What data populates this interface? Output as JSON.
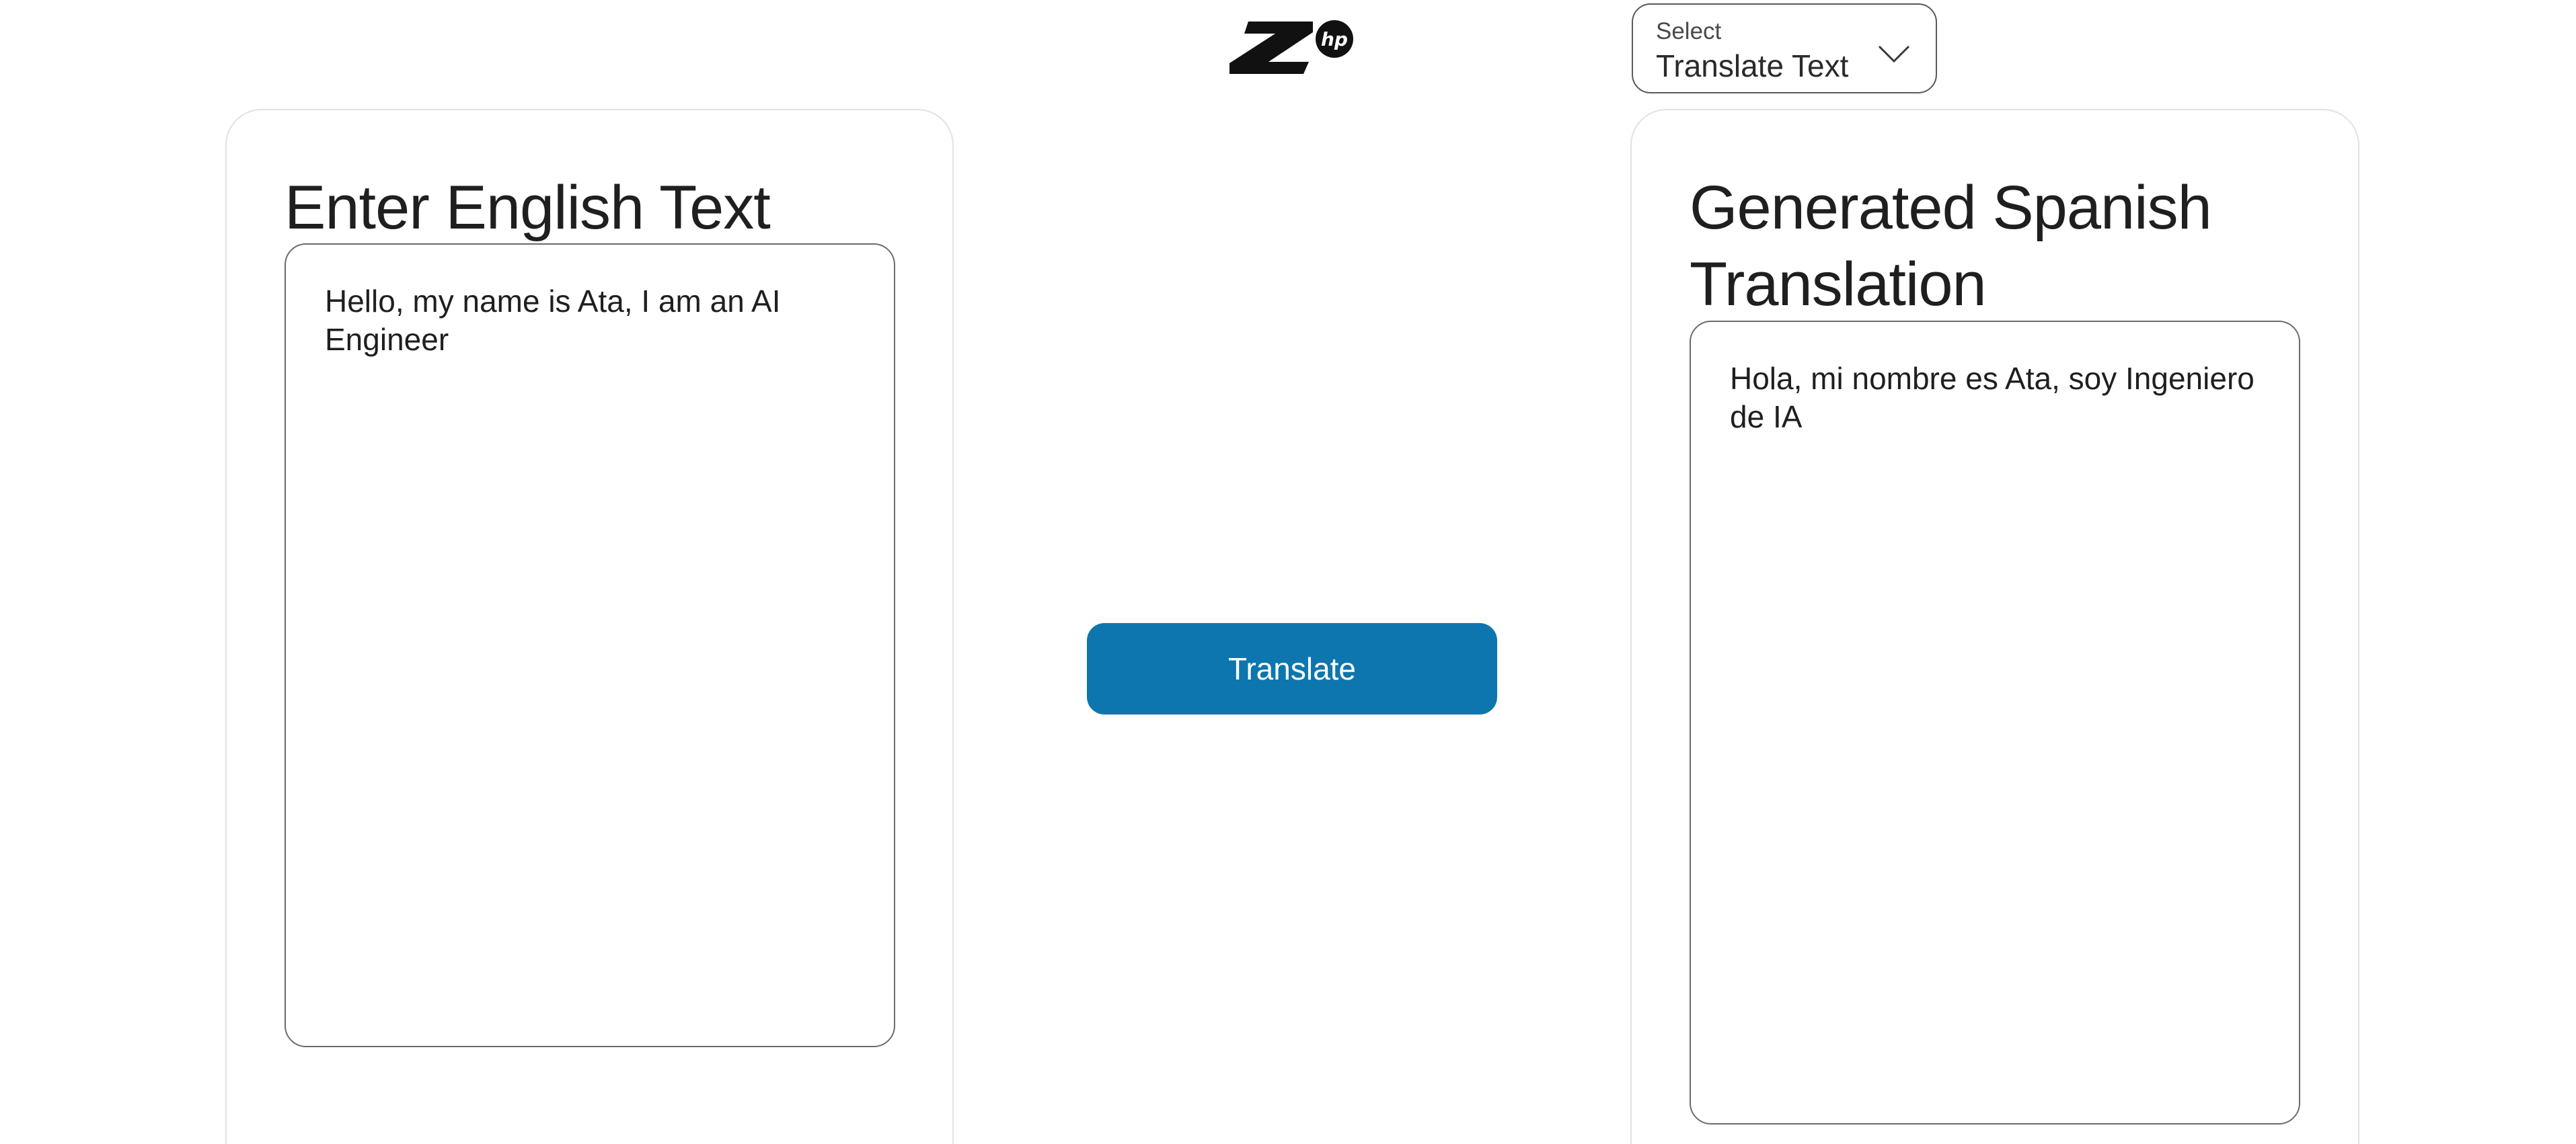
{
  "header": {
    "logo_icon": "hp-z-logo",
    "select": {
      "label": "Select",
      "value": "Translate Text",
      "icon": "chevron-down-icon"
    }
  },
  "input_panel": {
    "title": "Enter English Text",
    "text": "Hello, my name is Ata, I am an AI Engineer"
  },
  "action": {
    "translate_label": "Translate"
  },
  "output_panel": {
    "title": "Generated Spanish Translation",
    "text": "Hola, mi nombre es Ata, soy Ingeniero de IA"
  },
  "colors": {
    "primary_button": "#0d76ae",
    "text": "#1f1f1f",
    "border": "#6b6b6b",
    "card_border": "#e2e2e2"
  }
}
